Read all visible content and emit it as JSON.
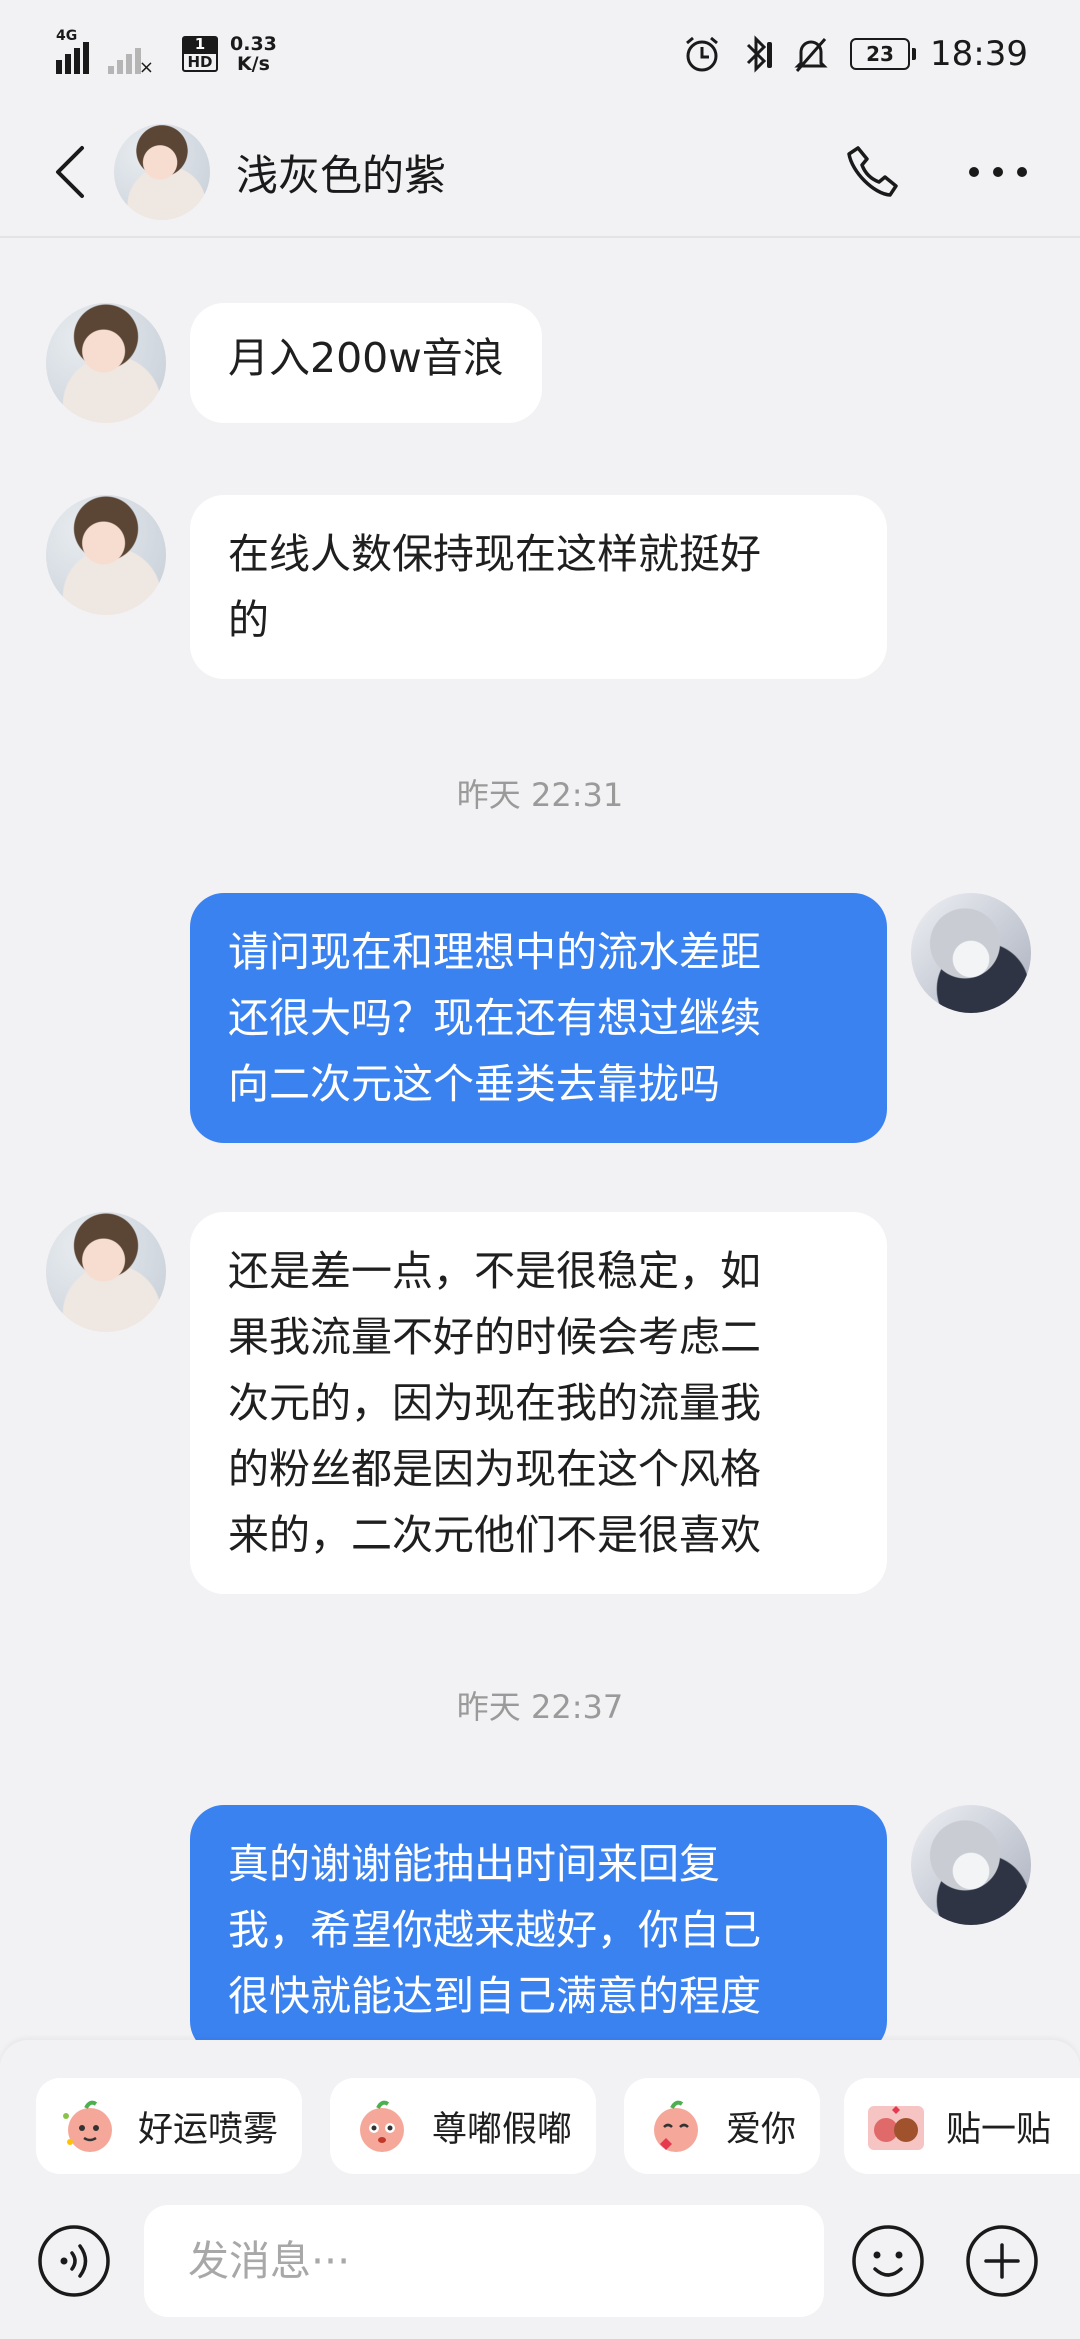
{
  "status_bar": {
    "network_type": "4G",
    "sim2_label": "1",
    "hd_label": "HD",
    "net_speed_value": "0.33",
    "net_speed_unit": "K/s",
    "battery_level": "23",
    "time": "18:39"
  },
  "header": {
    "contact_name": "浅灰色的紫"
  },
  "messages": [
    {
      "side": "in",
      "lines": [
        "月入200w音浪"
      ]
    },
    {
      "side": "in",
      "lines": [
        "在线人数保持现在这样就挺好",
        "的"
      ]
    },
    {
      "timestamp": "昨天 22:31"
    },
    {
      "side": "out",
      "lines": [
        "请问现在和理想中的流水差距",
        "还很大吗？现在还有想过继续",
        "向二次元这个垂类去靠拢吗"
      ]
    },
    {
      "side": "in",
      "lines": [
        "还是差一点，不是很稳定，如",
        "果我流量不好的时候会考虑二",
        "次元的，因为现在我的流量我",
        "的粉丝都是因为现在这个风格",
        "来的，二次元他们不是很喜欢"
      ]
    },
    {
      "timestamp": "昨天 22:37"
    },
    {
      "side": "out",
      "lines": [
        "真的谢谢能抽出时间来回复",
        "我，希望你越来越好，你自己",
        "很快就能达到自己满意的程度"
      ]
    }
  ],
  "quick_replies": [
    {
      "label": "好运喷雾",
      "icon": "lucky-spray-sticker-icon"
    },
    {
      "label": "尊嘟假嘟",
      "icon": "really-sticker-icon"
    },
    {
      "label": "爱你",
      "icon": "love-you-sticker-icon"
    },
    {
      "label": "贴一贴",
      "icon": "hug-sticker-icon"
    }
  ],
  "input": {
    "placeholder": "发消息···"
  },
  "colors": {
    "background": "#f2f2f4",
    "outgoing_bubble": "#3b82f1",
    "incoming_bubble": "#ffffff",
    "timestamp_text": "#9a9a9a"
  }
}
